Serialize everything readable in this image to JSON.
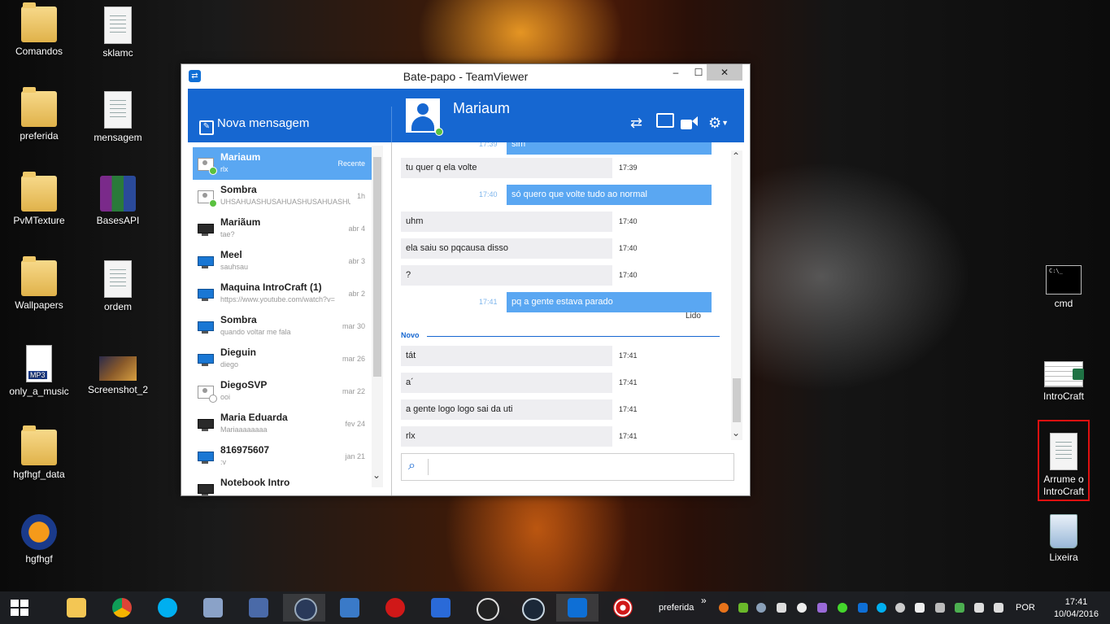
{
  "desktop": {
    "icons": [
      {
        "label": "Comandos"
      },
      {
        "label": "sklamc"
      },
      {
        "label": "preferida"
      },
      {
        "label": "mensagem"
      },
      {
        "label": "PvMTexture"
      },
      {
        "label": "BasesAPI"
      },
      {
        "label": "Wallpapers"
      },
      {
        "label": "ordem"
      },
      {
        "label": "only_a_music"
      },
      {
        "label": "Screenshot_2"
      },
      {
        "label": "hgfhgf_data"
      },
      {
        "label": "hgfhgf"
      },
      {
        "label": "cmd"
      },
      {
        "label": "IntroCraft"
      },
      {
        "label": "Arrume o IntroCraft"
      },
      {
        "label": "Lixeira"
      }
    ],
    "mp3_badge": "MP3",
    "cmd_text": "C:\\_"
  },
  "window": {
    "title": "Bate-papo - TeamViewer",
    "minimize": "–",
    "maximize": "☐",
    "close": "✕",
    "new_message": "Nova mensagem",
    "contact_name": "Mariaum"
  },
  "contacts": [
    {
      "name": "Mariaum",
      "preview": "rlx",
      "time": "Recente"
    },
    {
      "name": "Sombra",
      "preview": "UHSAHUASHUSAHUASHUSAHUASHUSAHUAS",
      "time": "1h"
    },
    {
      "name": "Mariãum",
      "preview": "tae?",
      "time": "abr 4"
    },
    {
      "name": "Meel",
      "preview": "sauhsau",
      "time": "abr 3"
    },
    {
      "name": "Maquina IntroCraft (1)",
      "preview": "https://www.youtube.com/watch?v=",
      "time": "abr 2"
    },
    {
      "name": "Sombra",
      "preview": "quando voltar me fala",
      "time": "mar 30"
    },
    {
      "name": "Dieguin",
      "preview": "diego",
      "time": "mar 26"
    },
    {
      "name": "DiegoSVP",
      "preview": "ooi",
      "time": "mar 22"
    },
    {
      "name": "Maria Eduarda",
      "preview": "Mariaaaaaaaa",
      "time": "fev 24"
    },
    {
      "name": "816975607",
      "preview": ":v",
      "time": "jan 21"
    },
    {
      "name": "Notebook Intro",
      "preview": "",
      "time": ""
    }
  ],
  "messages": [
    {
      "dir": "out",
      "text": "sim",
      "time": "17:39"
    },
    {
      "dir": "in",
      "text": "tu quer q ela volte",
      "time": "17:39"
    },
    {
      "dir": "out",
      "text": "só quero que volte tudo ao normal",
      "time": "17:40"
    },
    {
      "dir": "in",
      "text": "uhm",
      "time": "17:40"
    },
    {
      "dir": "in",
      "text": "ela saiu so pqcausa disso",
      "time": "17:40"
    },
    {
      "dir": "in",
      "text": "?",
      "time": "17:40"
    },
    {
      "dir": "out",
      "text": "pq a gente estava parado",
      "time": "17:41"
    },
    {
      "dir": "in",
      "text": "tát",
      "time": "17:41"
    },
    {
      "dir": "in",
      "text": "a´",
      "time": "17:41"
    },
    {
      "dir": "in",
      "text": "a gente logo logo sai da uti",
      "time": "17:41"
    },
    {
      "dir": "in",
      "text": "rlx",
      "time": "17:41"
    }
  ],
  "chat": {
    "read_label": "Lido",
    "new_label": "Novo",
    "input_value": "",
    "input_placeholder": ""
  },
  "taskbar": {
    "toolbar_label": "preferida",
    "toolbar_chevron": "»",
    "language": "POR",
    "time": "17:41",
    "date": "10/04/2016"
  },
  "colors": {
    "accent": "#1667d1",
    "bubble_out": "#5aa7f2",
    "bubble_in": "#eeeef1",
    "online": "#5ac13f"
  }
}
